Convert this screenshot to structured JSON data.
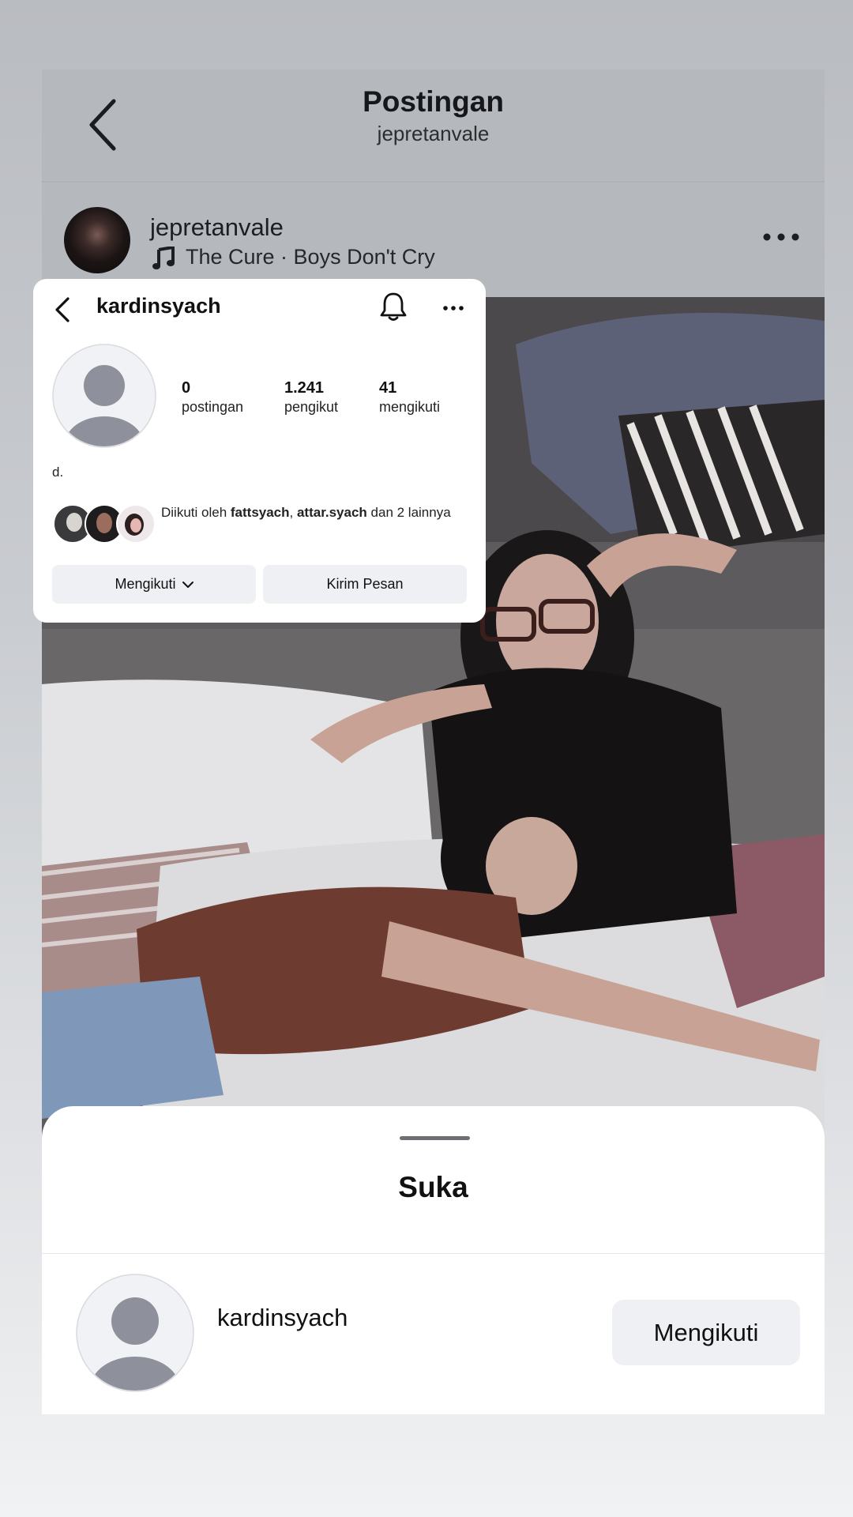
{
  "header": {
    "title": "Postingan",
    "subtitle": "jepretanvale"
  },
  "post": {
    "username": "jepretanvale",
    "music": "The Cure · Boys Don't Cry"
  },
  "profile_card": {
    "username": "kardinsyach",
    "stats": [
      {
        "value": "0",
        "label": "postingan"
      },
      {
        "value": "1.241",
        "label": "pengikut"
      },
      {
        "value": "41",
        "label": "mengikuti"
      }
    ],
    "bio": "d.",
    "followed_by_prefix": "Diikuti oleh ",
    "followed_by_user1": "fattsyach",
    "followed_by_sep": ", ",
    "followed_by_user2": "attar.syach",
    "followed_by_suffix": " dan 2 lainnya",
    "following_button": "Mengikuti",
    "message_button": "Kirim Pesan"
  },
  "likes_sheet": {
    "title": "Suka",
    "user": "kardinsyach",
    "follow_button": "Mengikuti"
  },
  "colors": {
    "background": "#c9ccd0",
    "button_bg": "#eef0f3",
    "text": "#111111"
  },
  "icons": [
    "back-icon",
    "music-note-icon",
    "more-icon",
    "bell-icon",
    "chevron-down-icon",
    "default-avatar-icon"
  ]
}
